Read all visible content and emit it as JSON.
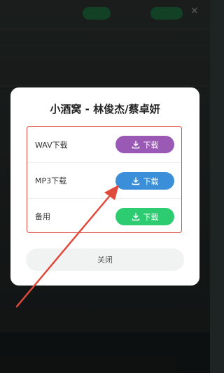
{
  "dialog": {
    "title": "小酒窝 - 林俊杰/蔡卓妍",
    "options": [
      {
        "label": "WAV下载",
        "button": "下载",
        "color": "#9b59b6"
      },
      {
        "label": "MP3下载",
        "button": "下载",
        "color": "#3a8fd8"
      },
      {
        "label": "备用",
        "button": "下载",
        "color": "#2ecc71"
      }
    ],
    "close_label": "关闭"
  },
  "annotation": {
    "color": "#e04a3c"
  }
}
